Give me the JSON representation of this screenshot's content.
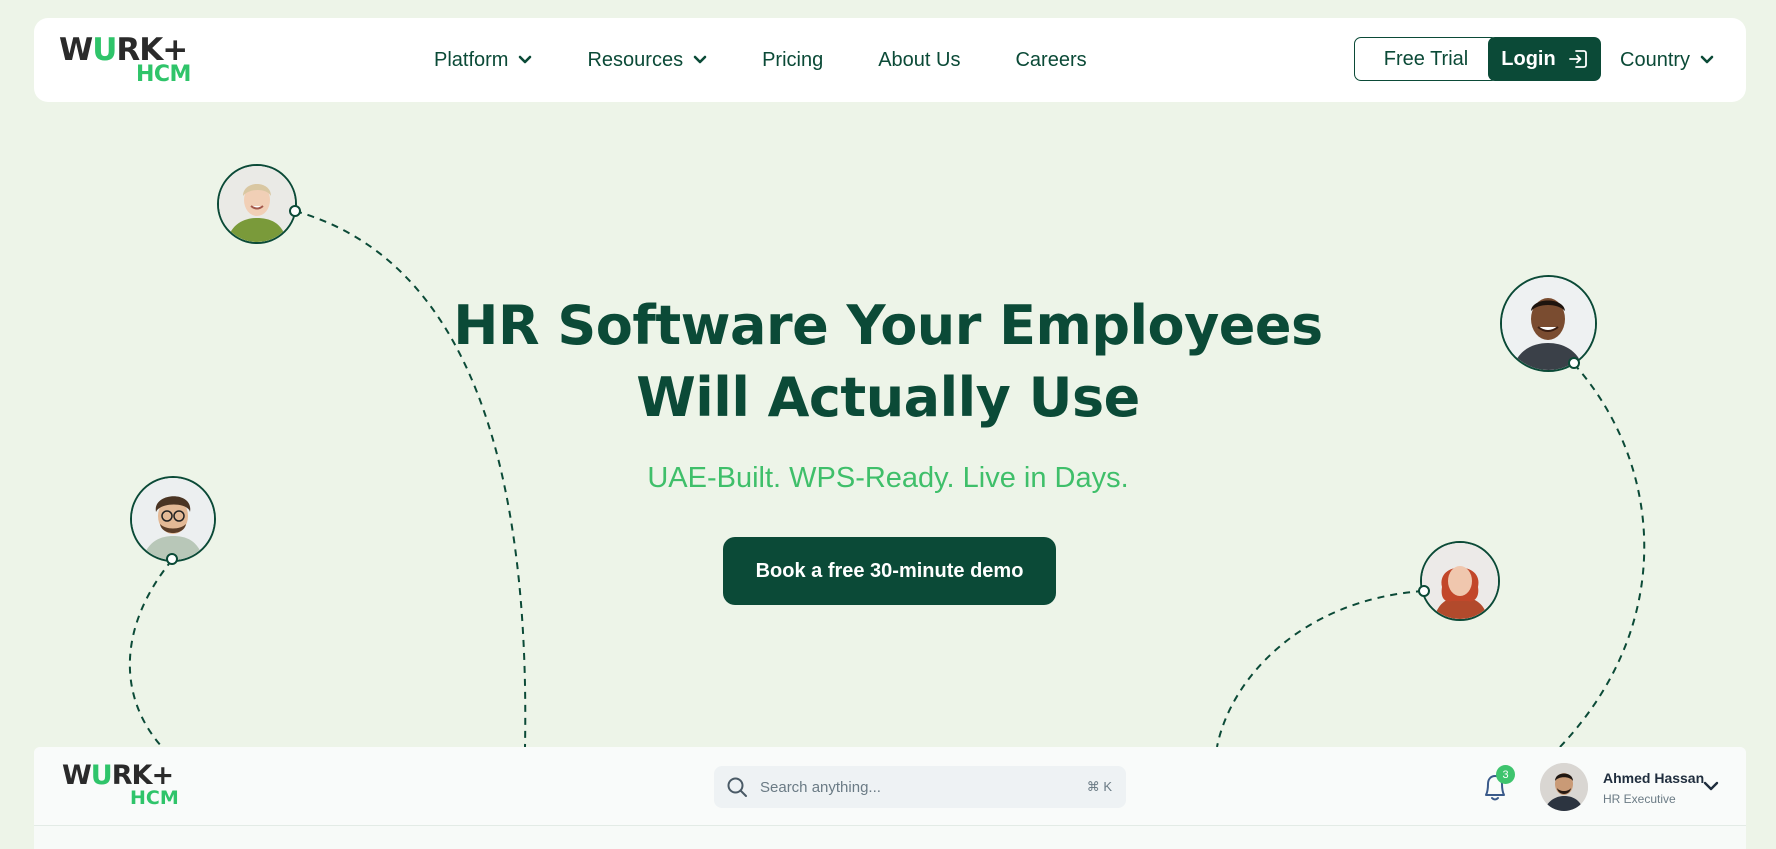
{
  "brand": {
    "logo_top_left": "W",
    "logo_top_o": "U",
    "logo_top_right": "RK+",
    "logo_bottom": "HCM"
  },
  "nav": {
    "items": [
      {
        "label": "Platform",
        "has_dropdown": true
      },
      {
        "label": "Resources",
        "has_dropdown": true
      },
      {
        "label": "Pricing",
        "has_dropdown": false
      },
      {
        "label": "About Us",
        "has_dropdown": false
      },
      {
        "label": "Careers",
        "has_dropdown": false
      }
    ],
    "free_trial": "Free Trial",
    "login": "Login",
    "country": "Country"
  },
  "hero": {
    "headline_line1": "HR Software Your Employees",
    "headline_line2": "Will Actually Use",
    "subheadline": "UAE-Built. WPS-Ready. Live in Days.",
    "cta": "Book a free 30-minute demo"
  },
  "preview": {
    "search_placeholder": "Search anything...",
    "search_shortcut": "⌘ K",
    "notification_count": "3",
    "user_name": "Ahmed Hassan",
    "user_role": "HR Executive"
  },
  "colors": {
    "primary": "#0b4a37",
    "accent": "#3fbf6a",
    "background": "#edf4e8"
  }
}
